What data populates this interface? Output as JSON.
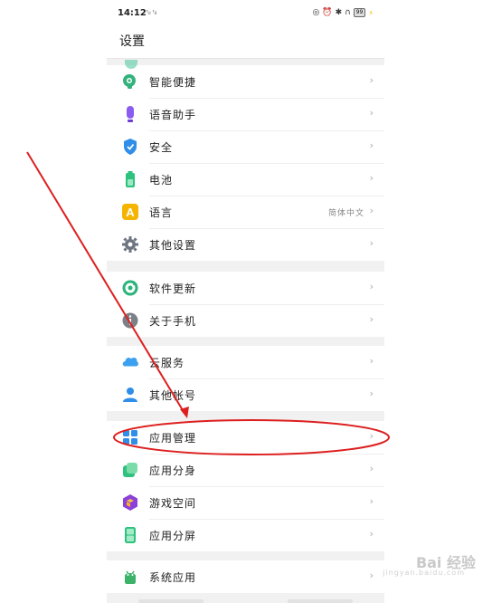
{
  "status": {
    "time": "14:12",
    "signal": "ᵗᵢₗ ᵗᵢₗ",
    "battery": "99"
  },
  "header": {
    "title": "设置"
  },
  "groups": [
    {
      "items": [
        {
          "label": "智能便捷",
          "chevron": "›",
          "icon": "smart-assist-icon"
        },
        {
          "label": "语音助手",
          "chevron": "›",
          "icon": "microphone-icon"
        },
        {
          "label": "安全",
          "chevron": "›",
          "icon": "shield-icon"
        },
        {
          "label": "电池",
          "chevron": "›",
          "icon": "battery-icon"
        },
        {
          "label": "语言",
          "value": "简体中文",
          "chevron": "›",
          "icon": "language-icon"
        },
        {
          "label": "其他设置",
          "chevron": "›",
          "icon": "gear-icon"
        }
      ]
    },
    {
      "items": [
        {
          "label": "软件更新",
          "chevron": "›",
          "icon": "update-icon"
        },
        {
          "label": "关于手机",
          "chevron": "›",
          "icon": "info-icon"
        }
      ]
    },
    {
      "items": [
        {
          "label": "云服务",
          "chevron": "›",
          "icon": "cloud-icon"
        },
        {
          "label": "其他帐号",
          "chevron": "›",
          "icon": "account-icon"
        }
      ]
    },
    {
      "items": [
        {
          "label": "应用管理",
          "chevron": "›",
          "icon": "app-manage-icon"
        },
        {
          "label": "应用分身",
          "chevron": "›",
          "icon": "app-clone-icon"
        },
        {
          "label": "游戏空间",
          "chevron": "›",
          "icon": "game-space-icon"
        },
        {
          "label": "应用分屏",
          "chevron": "›",
          "icon": "split-screen-icon"
        }
      ]
    },
    {
      "items": [
        {
          "label": "系统应用",
          "chevron": "›",
          "icon": "system-apps-icon"
        }
      ]
    }
  ],
  "watermark": {
    "brand": "Bai 经验",
    "sub": "jingyan.baidu.com"
  },
  "colors": {
    "annotation": "#dd1f1f",
    "background": "#f1f1f1"
  }
}
